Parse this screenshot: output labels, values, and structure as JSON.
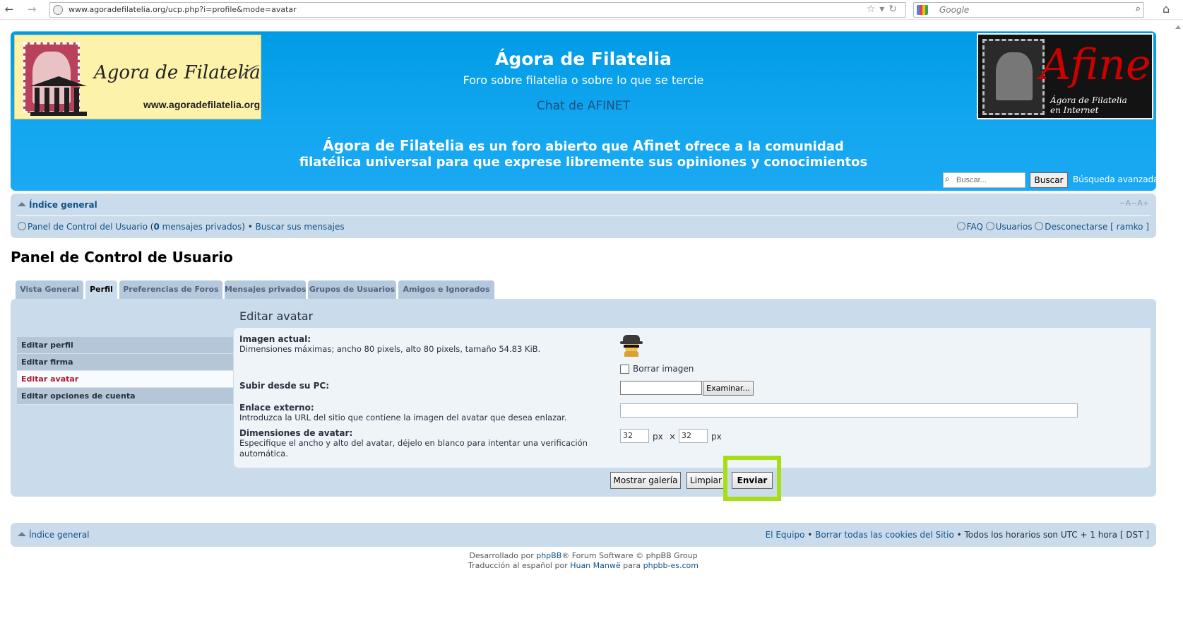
{
  "browser": {
    "url": "www.agoradefilatelia.org/ucp.php?i=profile&mode=avatar",
    "search_placeholder": "Google"
  },
  "header": {
    "logo_left_title": "Agora de Filatelia",
    "logo_left_url": "www.agoradefilatelia.org",
    "logo_right_word": "Afinet",
    "logo_right_sub1": "Ágora de Filatelia",
    "logo_right_sub2": "en Internet",
    "site_title": "Ágora de Filatelia",
    "site_desc": "Foro sobre filatelia o sobre lo que se tercie",
    "chat_link": "Chat de AFINET",
    "tagline_a": "Ágora de Filatelia",
    "tagline_b": " es un foro abierto que ",
    "tagline_c": "Afinet",
    "tagline_d": " ofrece a la comunidad",
    "tagline_line2": "filatélica universal para que exprese libremente sus opiniones y conocimientos",
    "search_placeholder": "Buscar...",
    "search_button": "Buscar",
    "advanced_search": "Búsqueda avanzada"
  },
  "navbar": {
    "index": "Índice general",
    "font_resize": "−A−A+",
    "ucp_link": "Panel de Control del Usuario",
    "pm_open": " (",
    "pm_count": "0",
    "pm_text": " mensajes privados",
    "pm_close": ")",
    "bullet": " • ",
    "search_own": "Buscar sus mensajes",
    "faq": "FAQ",
    "members": "Usuarios",
    "logout": "Desconectarse",
    "username": "[ ramko ]"
  },
  "page_title": "Panel de Control de Usuario",
  "tabs": [
    {
      "label": "Vista General"
    },
    {
      "label": "Perfil"
    },
    {
      "label": "Preferencias de Foros"
    },
    {
      "label": "Mensajes privados"
    },
    {
      "label": "Grupos de Usuarios"
    },
    {
      "label": "Amigos e Ignorados"
    }
  ],
  "sidemenu": [
    {
      "label": "Editar perfil"
    },
    {
      "label": "Editar firma"
    },
    {
      "label": "Editar avatar"
    },
    {
      "label": "Editar opciones de cuenta"
    }
  ],
  "form": {
    "heading": "Editar avatar",
    "current_label": "Imagen actual:",
    "current_explain": "Dimensiones máximas; ancho 80 pixels, alto 80 pixels, tamaño 54.83 KiB.",
    "delete_label": "Borrar imagen",
    "upload_label": "Subir desde su PC:",
    "browse_button": "Examinar...",
    "remote_label": "Enlace externo:",
    "remote_explain": "Introduzca la URL del sitio que contiene la imagen del avatar que desea enlazar.",
    "dims_label": "Dimensiones de avatar:",
    "dims_explain_1": "Especifique el ancho y alto del avatar, déjelo en blanco para intentar una verificación",
    "dims_explain_2": "automática.",
    "width": "32",
    "height": "32",
    "px": "px",
    "times": "×"
  },
  "buttons": {
    "gallery": "Mostrar galería",
    "reset": "Limpiar",
    "submit": "Enviar"
  },
  "footer": {
    "index": "Índice general",
    "team": "El Equipo",
    "bullet": " • ",
    "delete_cookies": "Borrar todas las cookies del Sitio",
    "timezone": " • Todos los horarios son UTC + 1 hora [ DST ]",
    "powered_1": "Desarrollado por ",
    "phpbb": "phpBB",
    "powered_2": "® Forum Software © phpBB Group",
    "trans_1": "Traducción al español por ",
    "translator": "Huan Manwë",
    "trans_2": " para ",
    "trans_site": "phpbb-es.com"
  }
}
